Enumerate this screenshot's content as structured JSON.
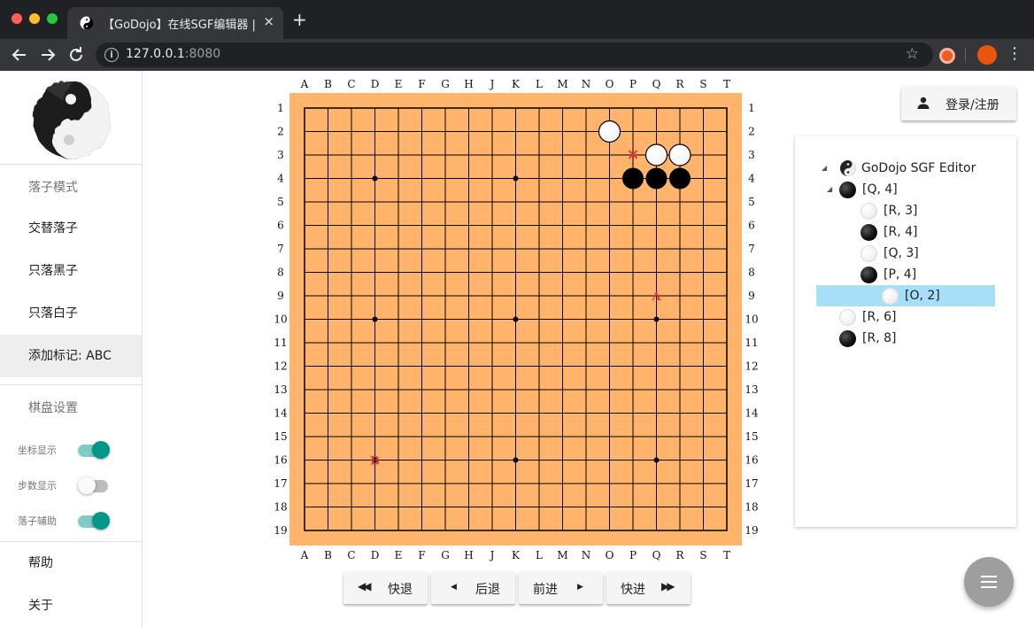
{
  "browser": {
    "tab_title": "【GoDojo】在线SGF编辑器 | SGF",
    "url_host": "127.0.0.1",
    "url_port": ":8080",
    "new_tab_symbol": "+",
    "close_symbol": "×"
  },
  "sidebar": {
    "section1": "落子模式",
    "mode_items": [
      "交替落子",
      "只落黑子",
      "只落白子",
      "添加标记: ABC"
    ],
    "active_mode": 3,
    "section2": "棋盘设置",
    "toggles": [
      {
        "label": "坐标显示",
        "on": true
      },
      {
        "label": "步数显示",
        "on": false
      },
      {
        "label": "落子辅助",
        "on": true
      }
    ],
    "footer_items": [
      "帮助",
      "关于"
    ]
  },
  "board": {
    "size": 19,
    "columns": [
      "A",
      "B",
      "C",
      "D",
      "E",
      "F",
      "G",
      "H",
      "J",
      "K",
      "L",
      "M",
      "N",
      "O",
      "P",
      "Q",
      "R",
      "S",
      "T"
    ],
    "rows": [
      "1",
      "2",
      "3",
      "4",
      "5",
      "6",
      "7",
      "8",
      "9",
      "10",
      "11",
      "12",
      "13",
      "14",
      "15",
      "16",
      "17",
      "18",
      "19"
    ],
    "background": "#ffb36b",
    "hoshi": [
      [
        "D",
        4
      ],
      [
        "K",
        4
      ],
      [
        "Q",
        4
      ],
      [
        "D",
        10
      ],
      [
        "K",
        10
      ],
      [
        "Q",
        10
      ],
      [
        "D",
        16
      ],
      [
        "K",
        16
      ],
      [
        "Q",
        16
      ]
    ],
    "stones": [
      {
        "col": "O",
        "row": 2,
        "color": "white"
      },
      {
        "col": "Q",
        "row": 3,
        "color": "white"
      },
      {
        "col": "R",
        "row": 3,
        "color": "white"
      },
      {
        "col": "P",
        "row": 4,
        "color": "black"
      },
      {
        "col": "Q",
        "row": 4,
        "color": "black"
      },
      {
        "col": "R",
        "row": 4,
        "color": "black"
      }
    ],
    "marks": [
      {
        "col": "P",
        "row": 3,
        "symbol": "×"
      },
      {
        "col": "Q",
        "row": 9,
        "symbol": "A"
      },
      {
        "col": "D",
        "row": 16,
        "symbol": "B"
      }
    ],
    "mark_color": "#e53935"
  },
  "controls": {
    "fast_back": "快退",
    "back": "后退",
    "forward": "前进",
    "fast_forward": "快进"
  },
  "login": {
    "label": "登录/注册"
  },
  "tree": {
    "root": "GoDojo SGF Editor",
    "nodes": [
      {
        "label": "[Q, 4]",
        "color": "black",
        "level": 1,
        "expanded": true
      },
      {
        "label": "[R, 3]",
        "color": "white",
        "level": 2
      },
      {
        "label": "[R, 4]",
        "color": "black",
        "level": 2
      },
      {
        "label": "[Q, 3]",
        "color": "white",
        "level": 2
      },
      {
        "label": "[P, 4]",
        "color": "black",
        "level": 2
      },
      {
        "label": "[O, 2]",
        "color": "white",
        "level": 2,
        "selected": true
      },
      {
        "label": "[R, 6]",
        "color": "white",
        "level": 1
      },
      {
        "label": "[R, 8]",
        "color": "black",
        "level": 1
      }
    ]
  }
}
